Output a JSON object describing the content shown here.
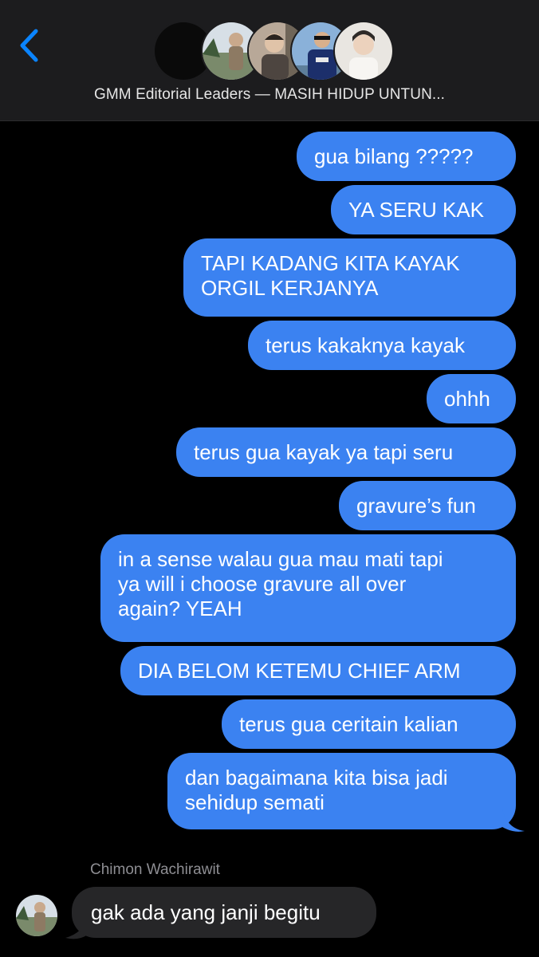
{
  "header": {
    "back_icon": "chevron-left-icon",
    "group_title": "GMM Editorial Leaders — MASIH HIDUP UNTUN...",
    "accent_color": "#0a84ff",
    "avatar_count": 5
  },
  "messages": {
    "outgoing_color": "#3b82f1",
    "incoming_color": "#262628",
    "outgoing": [
      "gua bilang ?????",
      "YA SERU KAK",
      "TAPI KADANG KITA KAYAK\nORGIL KERJANYA",
      "terus kakaknya kayak",
      "ohhh",
      "terus gua kayak ya tapi seru",
      "gravure’s fun",
      "in a sense walau gua mau mati tapi\nya will i choose gravure all over\nagain? YEAH",
      "DIA BELOM KETEMU CHIEF ARM",
      "terus gua ceritain kalian",
      "dan bagaimana kita bisa jadi\nsehidup semati"
    ],
    "incoming_sender": "Chimon Wachirawit",
    "incoming_text": "gak ada yang janji begitu"
  }
}
